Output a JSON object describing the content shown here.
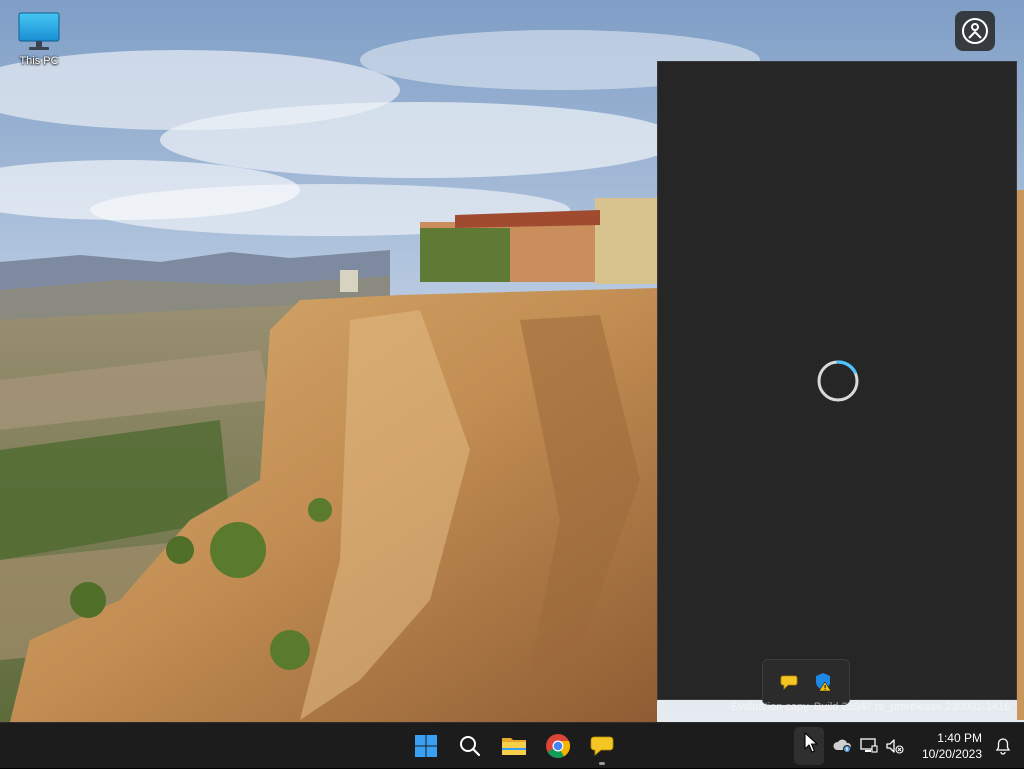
{
  "desktop": {
    "icons": [
      {
        "label": "This PC",
        "icon": "this-pc-icon"
      }
    ]
  },
  "corner_button": {
    "icon": "accessibility-person-icon"
  },
  "flyout": {
    "state": "loading",
    "icon": "loading-spinner-icon"
  },
  "tray_overflow": {
    "icons": [
      "chat-bubble-icon",
      "windows-security-warning-icon"
    ]
  },
  "watermark": "Evaluation copy. Build 25947.rs_prerelease.230901-1416",
  "taskbar": {
    "pinned": [
      {
        "name": "start",
        "icon": "windows-logo-icon"
      },
      {
        "name": "search",
        "icon": "search-icon"
      },
      {
        "name": "file-explorer",
        "icon": "folder-icon"
      },
      {
        "name": "chrome",
        "icon": "chrome-icon"
      },
      {
        "name": "feedback",
        "icon": "chat-bubble-icon",
        "running": true
      }
    ],
    "tray": {
      "chevron_icon": "chevron-up-icon",
      "icons": [
        "onedrive-icon",
        "network-icon",
        "volume-muted-icon"
      ],
      "time": "1:40 PM",
      "date": "10/20/2023",
      "notification_icon": "bell-icon"
    }
  },
  "colors": {
    "taskbar_bg": "#1c1c1c",
    "flyout_bg": "#262626",
    "accent": "#0078d4",
    "spinner": "#4cc2ff"
  }
}
